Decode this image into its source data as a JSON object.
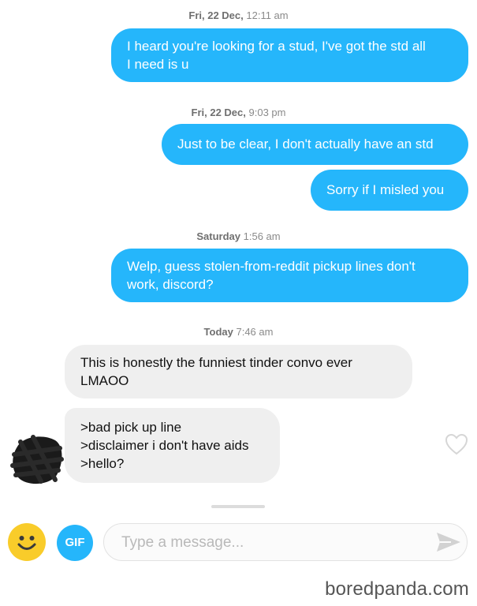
{
  "timestamps": [
    {
      "day": "Fri, 22 Dec,",
      "time": "12:11 am"
    },
    {
      "day": "Fri, 22 Dec,",
      "time": "9:03 pm"
    },
    {
      "day": "Saturday",
      "time": "1:56 am"
    },
    {
      "day": "Today",
      "time": "7:46 am"
    }
  ],
  "messages": {
    "m1": [
      "I heard you're looking for a stud, I've got the std all",
      "I need is u"
    ],
    "m2": "Just to be clear, I don't actually have an std",
    "m3": "Sorry if I misled you",
    "m4": [
      "Welp, guess stolen-from-reddit pickup lines don't",
      "work, discord?"
    ],
    "m5": [
      "This is honestly the funniest tinder convo ever",
      "LMAOO"
    ],
    "m6": [
      ">bad pick up line",
      ">disclaimer i don't have aids",
      ">hello?"
    ]
  },
  "composer": {
    "gif_label": "GIF",
    "placeholder": "Type a message..."
  },
  "watermark": "boredpanda.com",
  "colors": {
    "outgoing_bubble": "#25b6fb",
    "incoming_bubble": "#efefef",
    "emoji": "#f9cc2a"
  },
  "icons": {
    "emoji": "smiley-face-icon",
    "heart": "heart-outline-icon",
    "send": "send-arrow-icon"
  }
}
